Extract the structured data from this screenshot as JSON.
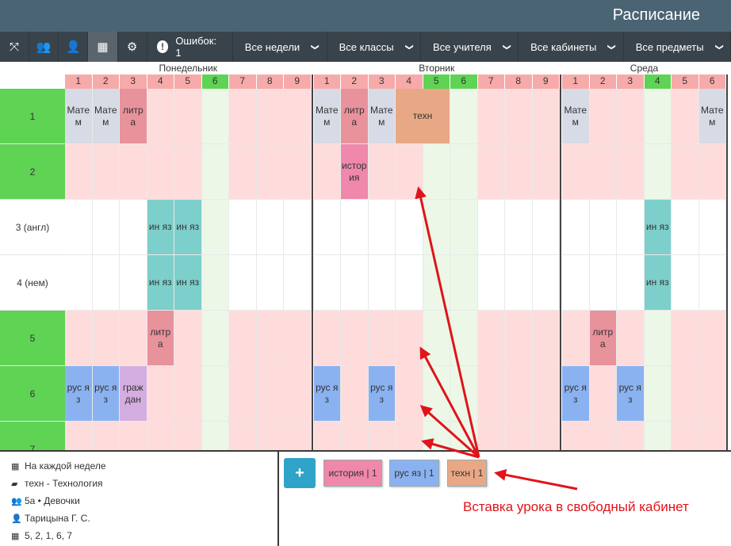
{
  "app": {
    "title": "Расписание"
  },
  "toolbar": {
    "buttons": [
      {
        "icon": "expand-icon",
        "glyph": "⤧",
        "active": false
      },
      {
        "icon": "users-icon",
        "glyph": "👥",
        "active": false
      },
      {
        "icon": "user-icon",
        "glyph": "👤",
        "active": false
      },
      {
        "icon": "building-icon",
        "glyph": "▦",
        "active": true
      },
      {
        "icon": "gears-icon",
        "glyph": "⚙",
        "active": false
      }
    ],
    "errors_label": "Ошибок: 1",
    "filters": [
      "Все недели",
      "Все классы",
      "Все учителя",
      "Все кабинеты",
      "Все предметы"
    ]
  },
  "colors": {
    "green": "#5ed354",
    "pink_row": "#ffdcdc",
    "green_col": "#ecf7e8",
    "col_header_pink": "#f7aaaa",
    "col_header_green": "#5ed354",
    "matem": "#d7dbe6",
    "litra": "#e8929c",
    "tehn": "#e9a885",
    "istoria": "#f088ab",
    "inyaz": "#7dcfcb",
    "rus": "#8bb2f0",
    "grazhd": "#d4aee0",
    "arrow": "#e0141a"
  },
  "days": [
    {
      "name": "Понедельник",
      "columns": [
        "1",
        "2",
        "3",
        "4",
        "5",
        "6",
        "7",
        "8",
        "9"
      ]
    },
    {
      "name": "Вторник",
      "columns": [
        "1",
        "2",
        "3",
        "4",
        "5",
        "6",
        "7",
        "8",
        "9"
      ]
    },
    {
      "name": "Среда",
      "columns": [
        "1",
        "2",
        "3",
        "4",
        "5",
        "6"
      ]
    }
  ],
  "green_columns": [
    [
      5
    ],
    [
      4,
      5
    ],
    [
      3
    ]
  ],
  "rows": [
    {
      "label": "1",
      "green": true,
      "pink": true
    },
    {
      "label": "2",
      "green": true,
      "pink": true
    },
    {
      "label": "3 (англ)",
      "green": false,
      "pink": false
    },
    {
      "label": "4 (нем)",
      "green": false,
      "pink": false
    },
    {
      "label": "5",
      "green": true,
      "pink": true
    },
    {
      "label": "6",
      "green": true,
      "pink": true
    },
    {
      "label": "7",
      "green": true,
      "pink": true
    }
  ],
  "lessons": [
    {
      "day": 0,
      "col": 0,
      "row": 0,
      "text": "Матем",
      "color": "matem"
    },
    {
      "day": 0,
      "col": 1,
      "row": 0,
      "text": "Матем",
      "color": "matem"
    },
    {
      "day": 0,
      "col": 2,
      "row": 0,
      "text": "литра",
      "color": "litra"
    },
    {
      "day": 0,
      "col": 3,
      "row": 2,
      "text": "ин яз",
      "color": "inyaz"
    },
    {
      "day": 0,
      "col": 4,
      "row": 2,
      "text": "ин яз",
      "color": "inyaz"
    },
    {
      "day": 0,
      "col": 3,
      "row": 3,
      "text": "ин яз",
      "color": "inyaz"
    },
    {
      "day": 0,
      "col": 4,
      "row": 3,
      "text": "ин яз",
      "color": "inyaz"
    },
    {
      "day": 0,
      "col": 3,
      "row": 4,
      "text": "литра",
      "color": "litra"
    },
    {
      "day": 0,
      "col": 0,
      "row": 5,
      "text": "рус яз",
      "color": "rus"
    },
    {
      "day": 0,
      "col": 1,
      "row": 5,
      "text": "рус яз",
      "color": "rus"
    },
    {
      "day": 0,
      "col": 2,
      "row": 5,
      "text": "граждан",
      "color": "grazhd"
    },
    {
      "day": 1,
      "col": 0,
      "row": 0,
      "text": "Матем",
      "color": "matem"
    },
    {
      "day": 1,
      "col": 1,
      "row": 0,
      "text": "литра",
      "color": "litra"
    },
    {
      "day": 1,
      "col": 2,
      "row": 0,
      "text": "Матем",
      "color": "matem"
    },
    {
      "day": 1,
      "col": 3,
      "row": 0,
      "span": 2,
      "text": "техн",
      "color": "tehn"
    },
    {
      "day": 1,
      "col": 1,
      "row": 1,
      "text": "история",
      "color": "istoria"
    },
    {
      "day": 1,
      "col": 0,
      "row": 5,
      "text": "рус яз",
      "color": "rus"
    },
    {
      "day": 1,
      "col": 2,
      "row": 5,
      "text": "рус яз",
      "color": "rus"
    },
    {
      "day": 2,
      "col": 0,
      "row": 0,
      "text": "Матем",
      "color": "matem"
    },
    {
      "day": 2,
      "col": 5,
      "row": 0,
      "text": "Матем",
      "color": "matem"
    },
    {
      "day": 2,
      "col": 3,
      "row": 2,
      "text": "ин яз",
      "color": "inyaz"
    },
    {
      "day": 2,
      "col": 3,
      "row": 3,
      "text": "ин яз",
      "color": "inyaz"
    },
    {
      "day": 2,
      "col": 1,
      "row": 4,
      "text": "литра",
      "color": "litra"
    },
    {
      "day": 2,
      "col": 0,
      "row": 5,
      "text": "рус яз",
      "color": "rus"
    },
    {
      "day": 2,
      "col": 2,
      "row": 5,
      "text": "рус яз",
      "color": "rus"
    }
  ],
  "info": {
    "items": [
      {
        "icon": "calendar-icon",
        "glyph": "▦",
        "text": "На каждой неделе"
      },
      {
        "icon": "book-icon",
        "glyph": "▰",
        "text": "техн - Технология"
      },
      {
        "icon": "users-icon",
        "glyph": "👥",
        "text": "5а • Девочки"
      },
      {
        "icon": "user-icon",
        "glyph": "👤",
        "text": "Тарицына Г. С."
      },
      {
        "icon": "building-icon",
        "glyph": "▦",
        "text": "5, 2, 1, 6, 7"
      }
    ]
  },
  "pool": {
    "add_label": "+",
    "chips": [
      {
        "text": "история | 1",
        "color": "istoria"
      },
      {
        "text": "рус яз | 1",
        "color": "rus"
      },
      {
        "text": "техн | 1",
        "color": "tehn"
      }
    ],
    "caption": "Вставка урока в свободный кабинет"
  }
}
